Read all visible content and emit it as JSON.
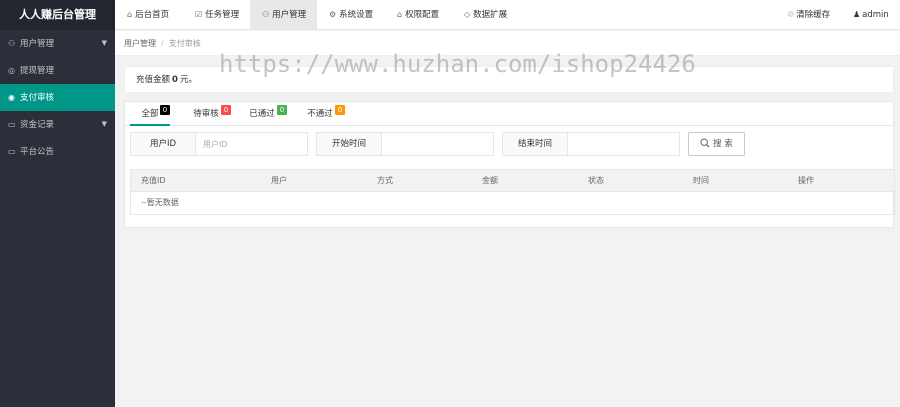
{
  "app": {
    "title": "人人赚后台管理"
  },
  "sidebar": {
    "items": [
      {
        "label": "用户管理",
        "icon": "user-icon",
        "glyph": "⚇",
        "has_arrow": true,
        "active": false
      },
      {
        "label": "提现管理",
        "icon": "withdraw-icon",
        "glyph": "◎",
        "has_arrow": false,
        "active": false
      },
      {
        "label": "支付审核",
        "icon": "payment-icon",
        "glyph": "◉",
        "has_arrow": false,
        "active": true
      },
      {
        "label": "资金记录",
        "icon": "funds-icon",
        "glyph": "▭",
        "has_arrow": true,
        "active": false
      },
      {
        "label": "平台公告",
        "icon": "announcement-icon",
        "glyph": "▭",
        "has_arrow": false,
        "active": false
      }
    ]
  },
  "topnav": {
    "tabs": [
      {
        "label": "后台首页",
        "icon": "home-icon",
        "glyph": "⌂"
      },
      {
        "label": "任务管理",
        "icon": "task-icon",
        "glyph": "☑"
      },
      {
        "label": "用户管理",
        "icon": "user-icon",
        "glyph": "⚇"
      },
      {
        "label": "系统设置",
        "icon": "gear-icon",
        "glyph": "⚙"
      },
      {
        "label": "权限配置",
        "icon": "lock-icon",
        "glyph": "⌂"
      },
      {
        "label": "数据扩展",
        "icon": "diamond-icon",
        "glyph": "◇"
      }
    ],
    "clear_cache": {
      "label": "清除缓存",
      "glyph": "♲"
    },
    "user": {
      "label": "admin",
      "glyph": "♟"
    }
  },
  "breadcrumb": {
    "parent": "用户管理",
    "separator": "/",
    "current": "支付审核"
  },
  "summary": {
    "prefix": "充值金额",
    "amount": "0",
    "suffix": "元。"
  },
  "tabs": [
    {
      "label": "全部",
      "count": "0",
      "color": "#000000"
    },
    {
      "label": "待审核",
      "count": "0",
      "color": "#ff4a4a"
    },
    {
      "label": "已通过",
      "count": "0",
      "color": "#4caf50"
    },
    {
      "label": "不通过",
      "count": "0",
      "color": "#ff9800"
    }
  ],
  "filters": {
    "user_id": {
      "label": "用户ID",
      "placeholder": "用户ID"
    },
    "start_time": {
      "label": "开始时间",
      "placeholder": ""
    },
    "end_time": {
      "label": "结束时间",
      "placeholder": ""
    },
    "search_label": "搜 索"
  },
  "table": {
    "columns": [
      "充值ID",
      "用户",
      "方式",
      "金额",
      "状态",
      "时间",
      "操作"
    ],
    "empty_text": "--暂无数据"
  },
  "watermark": "https://www.huzhan.com/ishop24426",
  "colors": {
    "accent": "#009688",
    "sidebar_bg": "#2b2f3a"
  }
}
